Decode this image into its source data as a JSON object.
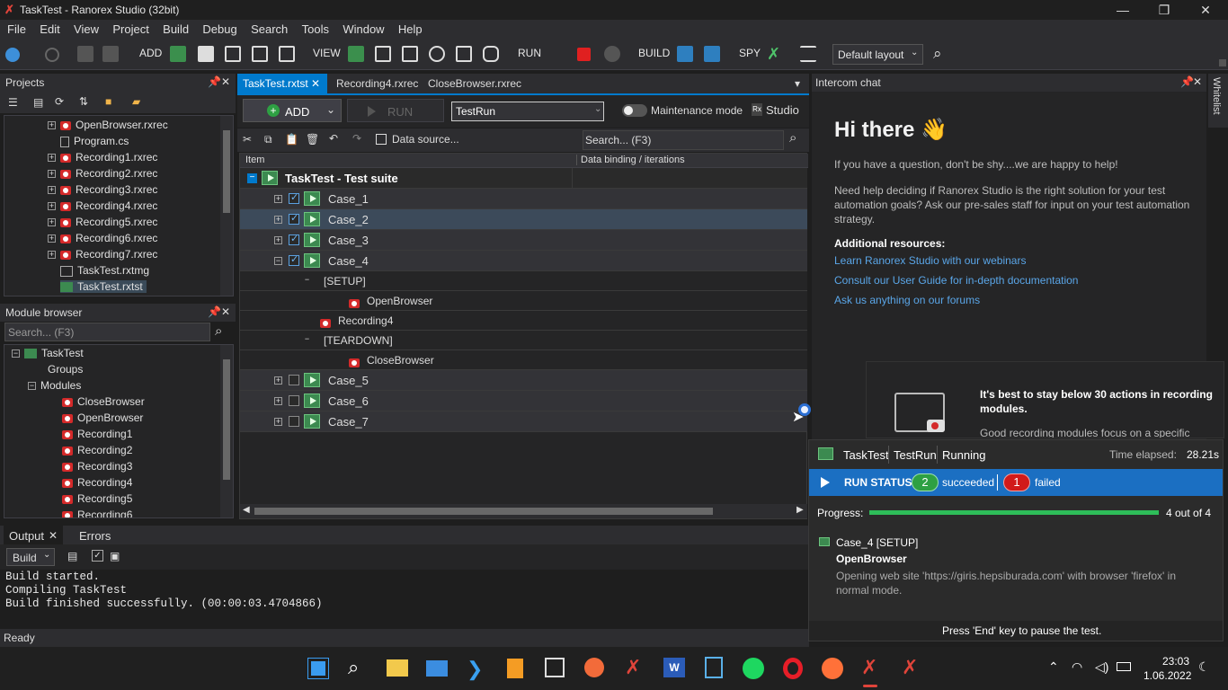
{
  "window": {
    "title": "TaskTest - Ranorex Studio (32bit)"
  },
  "menu": [
    "File",
    "Edit",
    "View",
    "Project",
    "Build",
    "Debug",
    "Search",
    "Tools",
    "Window",
    "Help"
  ],
  "toolbar": {
    "add": "ADD",
    "view": "VIEW",
    "run": "RUN",
    "build": "BUILD",
    "spy": "SPY",
    "layout": "Default layout"
  },
  "projects": {
    "title": "Projects",
    "items": [
      "OpenBrowser.rxrec",
      "Program.cs",
      "Recording1.rxrec",
      "Recording2.rxrec",
      "Recording3.rxrec",
      "Recording4.rxrec",
      "Recording5.rxrec",
      "Recording6.rxrec",
      "Recording7.rxrec",
      "TaskTest.rxtmg",
      "TaskTest.rxtst"
    ]
  },
  "module_browser": {
    "title": "Module browser",
    "search_placeholder": "Search... (F3)",
    "root": "TaskTest",
    "groups": "Groups",
    "modules": "Modules",
    "items": [
      "CloseBrowser",
      "OpenBrowser",
      "Recording1",
      "Recording2",
      "Recording3",
      "Recording4",
      "Recording5",
      "Recording6"
    ]
  },
  "tabs": [
    "TaskTest.rxtst",
    "Recording4.rxrec",
    "CloseBrowser.rxrec"
  ],
  "suite_toolbar": {
    "add": "ADD",
    "run": "RUN",
    "run_config": "TestRun",
    "maintenance": "Maintenance mode",
    "studio": "Studio",
    "data_source": "Data source...",
    "search_placeholder": "Search... (F3)"
  },
  "suite": {
    "col_item": "Item",
    "col_binding": "Data binding / iterations",
    "root": "TaskTest - Test suite",
    "cases": [
      {
        "label": "Case_1",
        "checked": true
      },
      {
        "label": "Case_2",
        "checked": true
      },
      {
        "label": "Case_3",
        "checked": true
      },
      {
        "label": "Case_4",
        "checked": true
      },
      {
        "label": "Case_5",
        "checked": false
      },
      {
        "label": "Case_6",
        "checked": false
      },
      {
        "label": "Case_7",
        "checked": false
      }
    ],
    "setup": "[SETUP]",
    "setup_item": "OpenBrowser",
    "case4_item": "Recording4",
    "teardown": "[TEARDOWN]",
    "teardown_item": "CloseBrowser"
  },
  "output": {
    "tabs": [
      "Output",
      "Errors"
    ],
    "build_select": "Build",
    "lines": [
      "Build started.",
      "Compiling TaskTest",
      "Build finished successfully. (00:00:03.4704866)"
    ]
  },
  "status": "Ready",
  "intercom": {
    "title": "Intercom chat",
    "greeting": "Hi there 👋",
    "p1": "If you have a question, don't be shy....we are happy to help!",
    "p2": "Need help deciding if Ranorex Studio is the right solution for your test automation goals? Ask our pre-sales staff for input on your test automation strategy.",
    "resources_title": "Additional resources:",
    "links": [
      "Learn Ranorex Studio with our webinars",
      "Consult our User Guide for in-depth documentation",
      "Ask us anything on our forums"
    ],
    "whitelist": "Whitelist"
  },
  "tip": {
    "title": "It's best to stay below 30 actions in recording modules.",
    "body": "Good recording modules focus on a specific"
  },
  "runner": {
    "suite": "TaskTest",
    "run": "TestRun",
    "state": "Running",
    "elapsed_label": "Time elapsed:",
    "elapsed": "28.21s",
    "status_label": "RUN STATUS",
    "succeeded_count": "2",
    "succeeded": "succeeded",
    "failed_count": "1",
    "failed": "failed",
    "progress_label": "Progress:",
    "progress_text": "4 out of 4",
    "progress": 1.0,
    "case": "Case_4 [SETUP]",
    "module": "OpenBrowser",
    "detail": "Opening web site 'https://giris.hepsiburada.com' with browser 'firefox' in normal mode.",
    "hint": "Press 'End' key to pause the test."
  },
  "taskbar": {
    "time": "23:03",
    "date": "1.06.2022"
  },
  "colors": {
    "accent": "#007acc",
    "success": "#2ea043",
    "failed": "#d11a1a",
    "progress": "#2ebd59"
  }
}
